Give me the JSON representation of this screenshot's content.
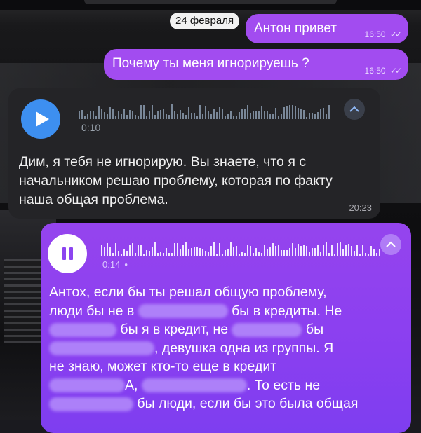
{
  "date_separator": "24 февраля",
  "messages": {
    "out1": {
      "text": "Антон привет",
      "time": "16:50"
    },
    "out2": {
      "text": "Почему ты меня игнорируешь ?",
      "time": "16:50"
    },
    "in_voice": {
      "duration": "0:10",
      "text": "Дим, я тебя не игнорирую. Вы знаете, что я с начальником решаю проблему, которая по факту наша общая проблема.",
      "time": "20:23"
    },
    "out_voice": {
      "duration": "0:14",
      "line1": "Антох, если бы ты решал общую проблему,",
      "line2a": "люди бы не в",
      "line2b": "бы в кредиты. Не",
      "line3a": "бы я в кредит, не",
      "line3b": "бы",
      "line4a": "",
      "line4b": ", девушка одна из группы. Я",
      "line5": "не знаю, может кто-то еще в кредит",
      "line6a": "А,",
      "line6b": ". То есть не",
      "line7a": "бы люди, если бы это была общая"
    }
  },
  "icons": {
    "play": "play-icon",
    "pause": "pause-icon",
    "chevron": "chevron-up-icon",
    "read": "double-check-icon"
  },
  "colors": {
    "outgoing": "#a24cf0",
    "incoming": "#242427",
    "play_button": "#3d8ff0"
  }
}
